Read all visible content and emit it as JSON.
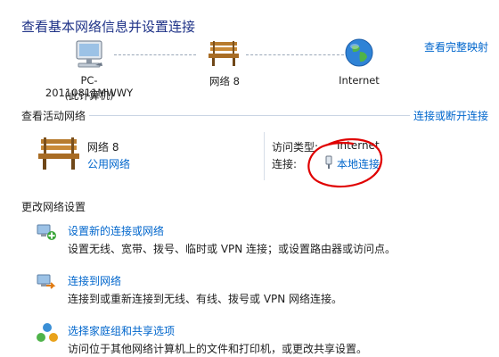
{
  "page": {
    "title": "查看基本网络信息并设置连接",
    "view_full_map": "查看完整映射"
  },
  "network_map": {
    "computer": {
      "name": "PC-20110811MWWY",
      "note": "(此计算机)"
    },
    "network": {
      "name": "网络 8"
    },
    "internet": {
      "name": "Internet"
    }
  },
  "active_networks": {
    "heading": "查看活动网络",
    "connect_disconnect": "连接或断开连接",
    "network_name": "网络 8",
    "network_type": "公用网络",
    "access_type_label": "访问类型:",
    "access_type_value": "Internet",
    "connection_label": "连接:",
    "connection_value": "本地连接"
  },
  "change_settings": {
    "heading": "更改网络设置",
    "options": [
      {
        "title": "设置新的连接或网络",
        "desc": "设置无线、宽带、拨号、临时或 VPN 连接；或设置路由器或访问点。"
      },
      {
        "title": "连接到网络",
        "desc": "连接到或重新连接到无线、有线、拨号或 VPN 网络连接。"
      },
      {
        "title": "选择家庭组和共享选项",
        "desc": "访问位于其他网络计算机上的文件和打印机，或更改共享设置。"
      }
    ]
  },
  "colors": {
    "title": "#1e3287",
    "link": "#0066cc",
    "annotation": "#e00000"
  },
  "icons": [
    "computer-icon",
    "bench-icon",
    "globe-icon",
    "connection-plug-icon",
    "new-connection-icon",
    "connect-network-icon",
    "homegroup-icon"
  ]
}
